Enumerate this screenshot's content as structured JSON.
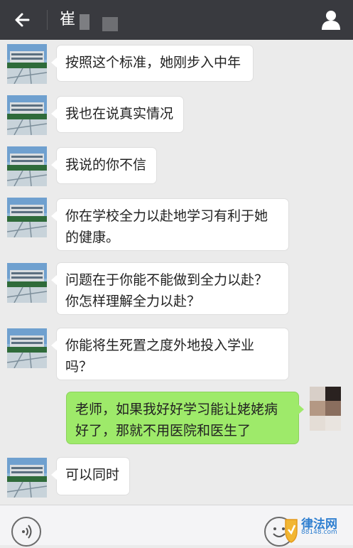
{
  "header": {
    "title": "崔"
  },
  "messages": [
    {
      "side": "in",
      "text": "按照这个标准，她刚步入中年"
    },
    {
      "side": "in",
      "text": "我也在说真实情况"
    },
    {
      "side": "in",
      "text": "我说的你不信"
    },
    {
      "side": "in",
      "text": "你在学校全力以赴地学习有利于她的健康。"
    },
    {
      "side": "in",
      "text": "问题在于你能不能做到全力以赴？你怎样理解全力以赴？"
    },
    {
      "side": "in",
      "text": "你能将生死置之度外地投入学业吗？"
    },
    {
      "side": "out",
      "text": "老师，如果我好好学习能让姥姥病好了，那就不用医院和医生了"
    },
    {
      "side": "in",
      "text": "可以同时"
    }
  ],
  "watermark": {
    "line1": "律法网",
    "line2": "88148.com"
  },
  "colors": {
    "topbar": "#393a3f",
    "chat_background": "#ebebeb",
    "incoming_bubble": "#ffffff",
    "outgoing_bubble": "#9eea6a"
  },
  "icons": {
    "back": "arrow-left-icon",
    "profile": "person-icon",
    "voice": "voice-icon",
    "emoji": "emoji-icon",
    "watermark": "shield-logo-icon"
  }
}
